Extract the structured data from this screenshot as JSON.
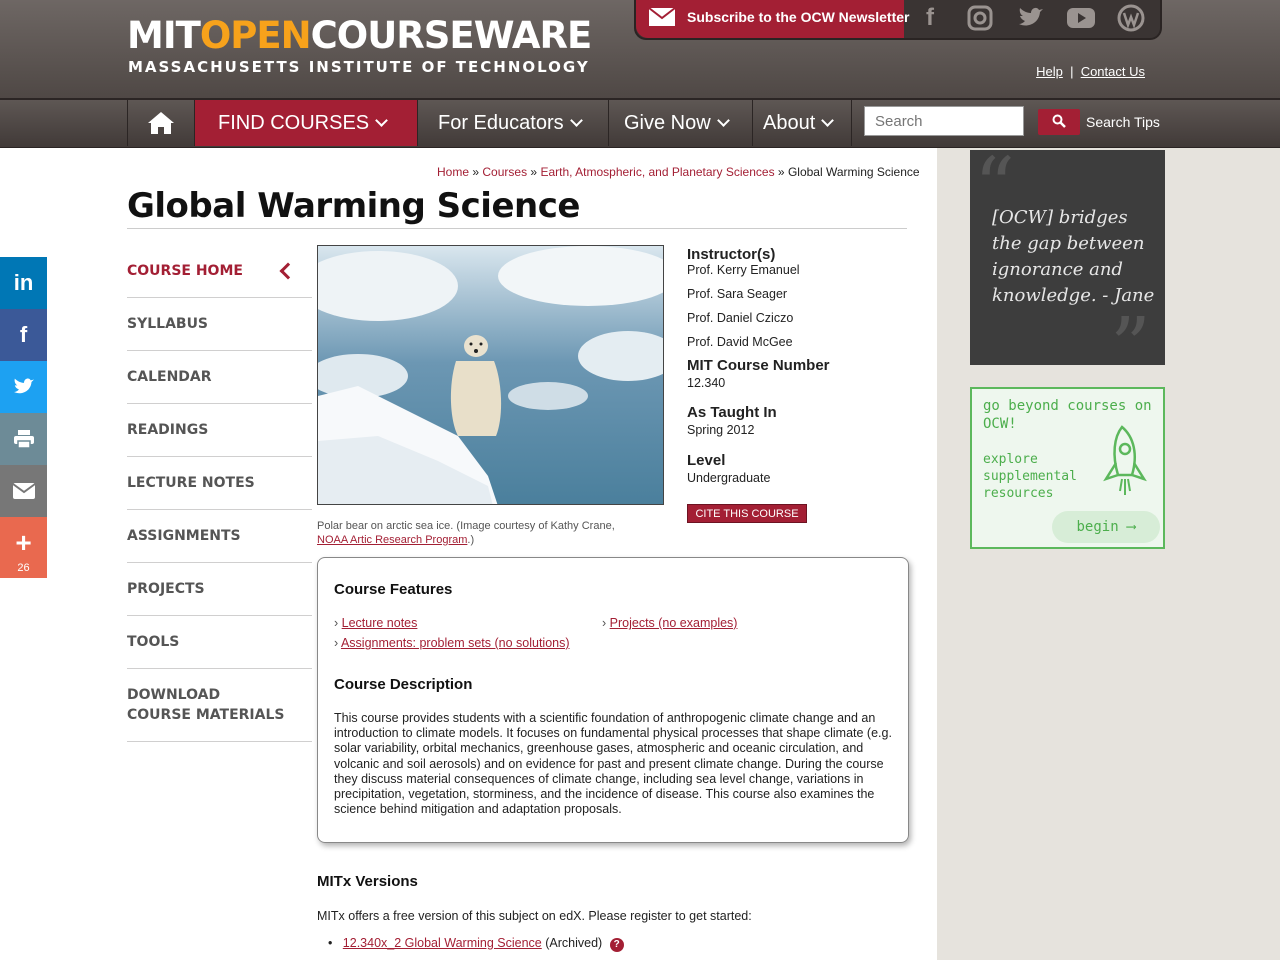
{
  "header": {
    "logo_part1": "MIT",
    "logo_part2": "OPEN",
    "logo_part3": "COURSEWARE",
    "logo_sub": "MASSACHUSETTS INSTITUTE OF TECHNOLOGY",
    "subscribe_label": "Subscribe to the OCW Newsletter",
    "help": "Help",
    "contact": "Contact Us",
    "social_icons": [
      "facebook-icon",
      "instagram-icon",
      "twitter-icon",
      "youtube-icon",
      "wordpress-icon"
    ]
  },
  "nav": {
    "find_courses": "FIND COURSES",
    "for_educators": "For Educators",
    "give_now": "Give Now",
    "about": "About",
    "search_placeholder": "Search",
    "search_tips": "Search Tips"
  },
  "share": {
    "count": "26",
    "colors": [
      "#0077b5",
      "#3b5998",
      "#1da1f2",
      "#6d8b97",
      "#777777",
      "#e9694f"
    ]
  },
  "breadcrumb": {
    "home": "Home",
    "sep": "»",
    "courses": "Courses",
    "dept": "Earth, Atmospheric, and Planetary Sciences",
    "current": "Global Warming Science"
  },
  "page_title": "Global Warming Science",
  "course_nav": [
    "COURSE HOME",
    "SYLLABUS",
    "CALENDAR",
    "READINGS",
    "LECTURE NOTES",
    "ASSIGNMENTS",
    "PROJECTS",
    "TOOLS",
    "DOWNLOAD COURSE MATERIALS"
  ],
  "image_caption": {
    "text": "Polar bear on arctic sea ice. (Image courtesy of Kathy Crane,",
    "link": "NOAA Artic Research Program",
    "tail": ".)"
  },
  "info": {
    "instructors_label": "Instructor(s)",
    "instructors": [
      "Prof. Kerry Emanuel",
      "Prof. Sara Seager",
      "Prof. Daniel Cziczo",
      "Prof. David McGee"
    ],
    "number_label": "MIT Course Number",
    "number": "12.340",
    "taught_label": "As Taught In",
    "taught": "Spring 2012",
    "level_label": "Level",
    "level": "Undergraduate",
    "cite": "CITE THIS COURSE"
  },
  "features": {
    "title": "Course Features",
    "items": [
      "Lecture notes",
      "Projects (no examples)",
      "Assignments: problem sets (no solutions)"
    ],
    "desc_title": "Course Description",
    "desc": "This course provides students with a scientific foundation of anthropogenic climate change and an introduction to climate models. It focuses on fundamental physical processes that shape climate (e.g. solar variability, orbital mechanics, greenhouse gases, atmospheric and oceanic circulation, and volcanic and soil aerosols) and on evidence for past and present climate change. During the course they discuss material consequences of climate change, including sea level change, variations in precipitation, vegetation, storminess, and the incidence of disease. This course also examines the science behind mitigation and adaptation proposals."
  },
  "mitx": {
    "title": "MITx Versions",
    "text": "MITx offers a free version of this subject on edX. Please register to get started:",
    "link": "12.340x_2 Global Warming Science",
    "suffix": "(Archived)",
    "help": "?"
  },
  "sidebar": {
    "quote": "[OCW] bridges the gap between ignorance and knowledge. - Jane",
    "beyond_title": "go beyond courses on OCW!",
    "explore": "explore supplemental resources",
    "begin": "begin ⟶"
  }
}
